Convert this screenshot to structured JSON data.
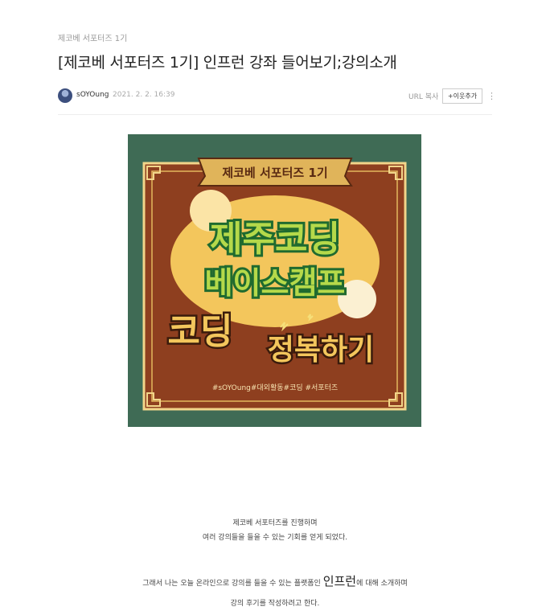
{
  "post": {
    "category": "제코베 서포터즈 1기",
    "title": "[제코베 서포터즈 1기] 인프런 강좌 들어보기;강의소개",
    "author": "sOYOung",
    "date": "2021. 2. 2. 16:39",
    "url_copy_label": "URL 복사",
    "add_neighbor_label": "+이웃추가",
    "more_icon": "⋮"
  },
  "poster": {
    "banner_text": "제코베 서포터즈 1기",
    "headline_line1": "제주코딩",
    "headline_line2": "베이스캠프",
    "subhead_part1": "코딩",
    "subhead_part2": "정복하기",
    "hashtags": "#sOYOung#대외활동#코딩 #서포터즈",
    "colors": {
      "frame_green": "#3f6b55",
      "brown": "#8e3f1f",
      "gold": "#f3c65c",
      "dark_green": "#1f6a2f",
      "lime": "#b5d94a"
    }
  },
  "body": {
    "para1_line1": "제코베 서포터즈를 진행하며",
    "para1_line2": "여러 강의들을 들을 수 있는 기회를 얻게 되었다.",
    "para2_prefix": "그래서 나는 오늘 온라인으로 강의를 들을 수 있는 플랫폼인 ",
    "para2_highlight": "인프런",
    "para2_suffix": "에 대해 소개하며",
    "para2_line2": "강의 후기를 작성하려고 한다."
  }
}
